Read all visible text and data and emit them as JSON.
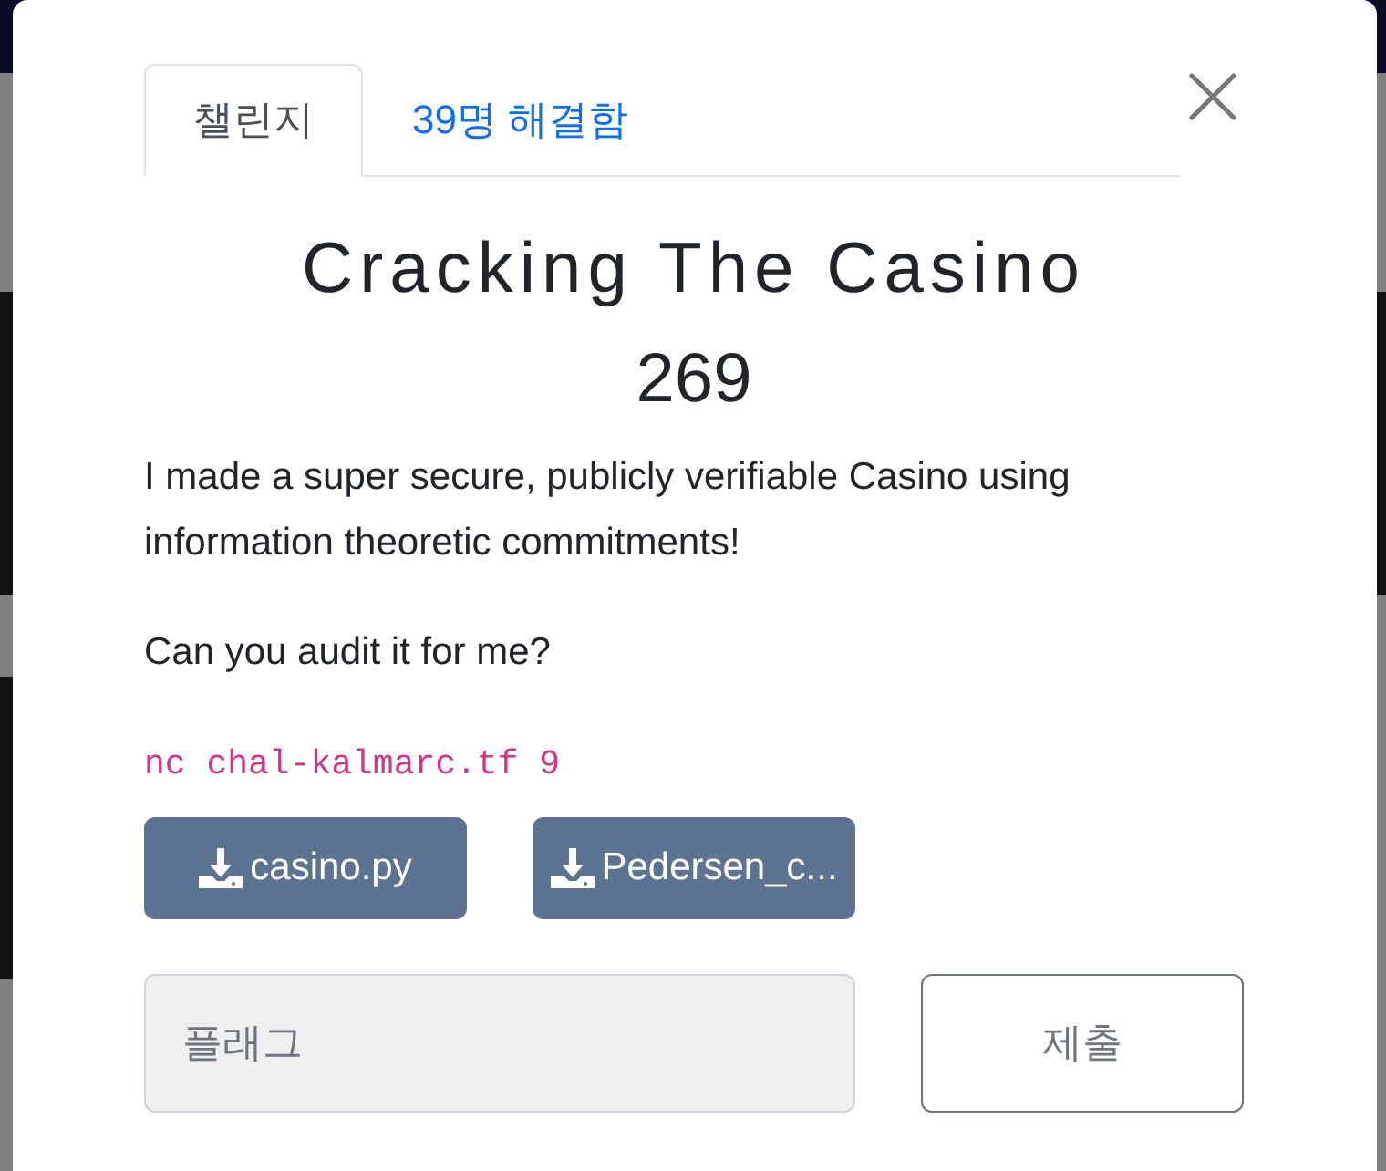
{
  "dialog": {
    "tabs": [
      {
        "label": "챌린지",
        "selected": true
      },
      {
        "label": "39명 해결함",
        "selected": false
      }
    ],
    "title": "Cracking The Casino",
    "points": "269",
    "description": [
      "I made a super secure, publicly verifiable Casino using information theoretic commitments!",
      "Can you audit it for me?"
    ],
    "connection": "nc chal-kalmarc.tf 9",
    "files": [
      "casino.py",
      "Pedersen_c..."
    ],
    "flag_input": {
      "placeholder": "플래그"
    },
    "submit_button": "제출"
  }
}
